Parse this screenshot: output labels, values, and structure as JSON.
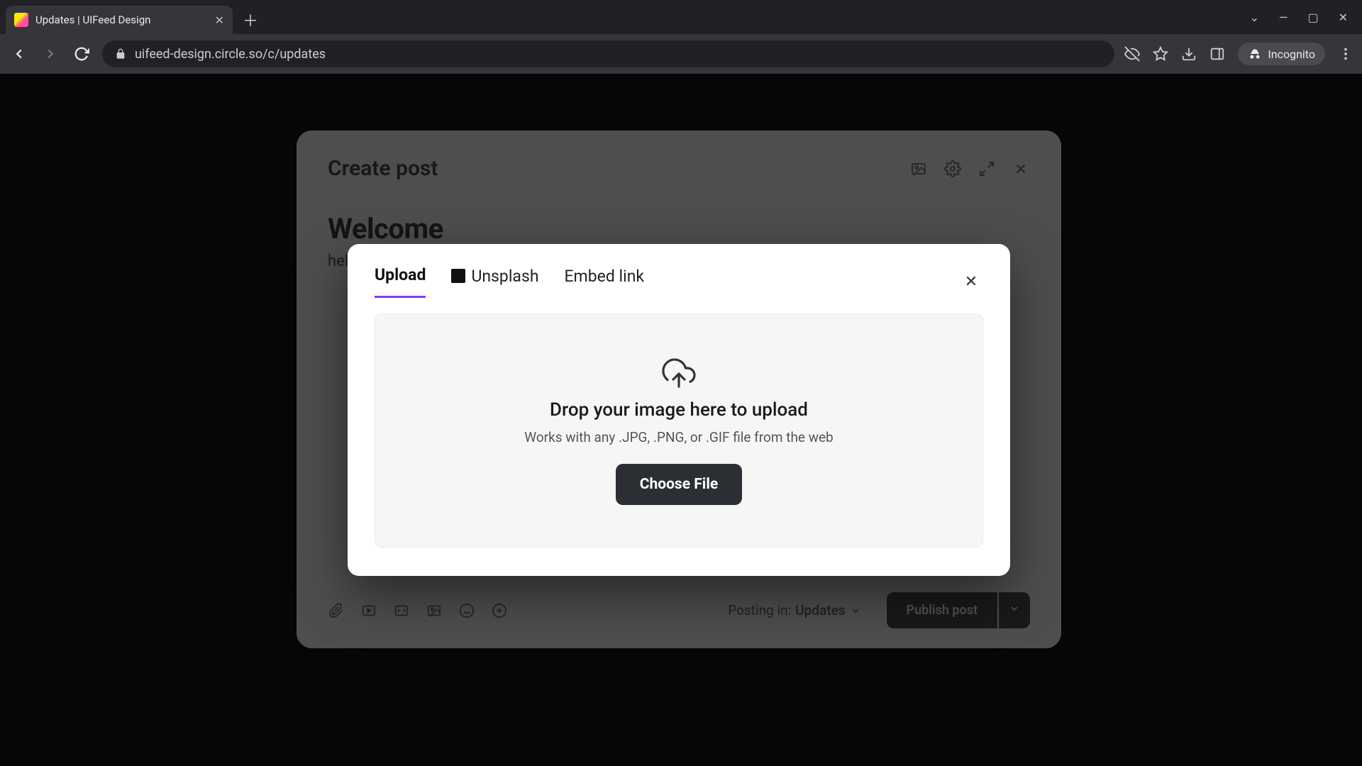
{
  "browser": {
    "tab_title": "Updates | UIFeed Design",
    "url": "uifeed-design.circle.so/c/updates",
    "incognito_label": "Incognito"
  },
  "post_modal": {
    "title": "Create post",
    "post_title": "Welcome",
    "post_body": "hell",
    "posting_in_prefix": "Posting in:",
    "posting_in_space": "Updates",
    "publish_label": "Publish post"
  },
  "upload_modal": {
    "tabs": {
      "upload": "Upload",
      "unsplash": "Unsplash",
      "embed": "Embed link"
    },
    "active_tab": "upload",
    "drop_heading": "Drop your image here to upload",
    "drop_sub": "Works with any .JPG, .PNG, or .GIF file from the web",
    "choose_label": "Choose File"
  }
}
